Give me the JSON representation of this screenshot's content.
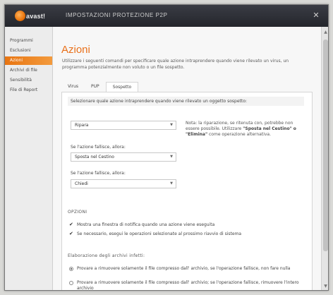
{
  "window": {
    "logo_text": "avast!",
    "title": "IMPOSTAZIONI PROTEZIONE P2P",
    "close_glyph": "✕"
  },
  "sidebar": {
    "items": [
      {
        "label": "Programmi",
        "active": false
      },
      {
        "label": "Esclusioni",
        "active": false
      },
      {
        "label": "Azioni",
        "active": true
      },
      {
        "label": "Archivi di file",
        "active": false
      },
      {
        "label": "Sensibilità",
        "active": false
      },
      {
        "label": "File di Report",
        "active": false
      }
    ]
  },
  "main": {
    "title": "Azioni",
    "description": "Utilizzare i seguenti comandi per specificare quale azione intraprendere quando viene rilevato un virus, un programma potenzialmente non voluto o un file sospetto.",
    "tabs": [
      {
        "label": "Virus",
        "active": false
      },
      {
        "label": "PUP",
        "active": false
      },
      {
        "label": "Sospetto",
        "active": true
      }
    ],
    "instruction": "Selezionare quale azione intraprendere quando viene rilevato un oggetto sospetto:",
    "primary_action": {
      "value": "Ripara"
    },
    "note_pre": "Nota: la riparazione, se ritenuta con, potrebbe non essere possibile. Utilizzare ",
    "note_bold": "\"Sposta nel Cestino\" o \"Elimina\"",
    "note_post": " come operazione alternativa.",
    "if_fail_label": "Se l'azione fallisce, allora:",
    "second_action": {
      "value": "Sposta nel Cestino"
    },
    "if_fail_label2": "Se l'azione fallisce, allora:",
    "third_action": {
      "value": "Chiedi"
    },
    "options_title": "OPZIONI",
    "options": [
      {
        "label": "Mostra una finestra di notifica quando una azione viene eseguita",
        "checked": true
      },
      {
        "label": "Se necessario, esegui le operazioni selezionate al prossimo riavvio di sistema",
        "checked": true
      }
    ],
    "archive_title": "Elaborazione degli archivi infetti:",
    "archive_options": [
      {
        "label": "Provare a rimuovere solamente il file compresso dall' archivio, se l'operazione fallisce, non fare nulla",
        "selected": true
      },
      {
        "label": "Provare a rimuovere solamente il file compresso dall' archivio; se l'operazione fallisce, rimuovere l'intero archivio",
        "selected": false
      }
    ],
    "dropdown_glyph": "▼"
  },
  "colors": {
    "accent": "#e9701a",
    "titlebar": "#2c2e34"
  }
}
